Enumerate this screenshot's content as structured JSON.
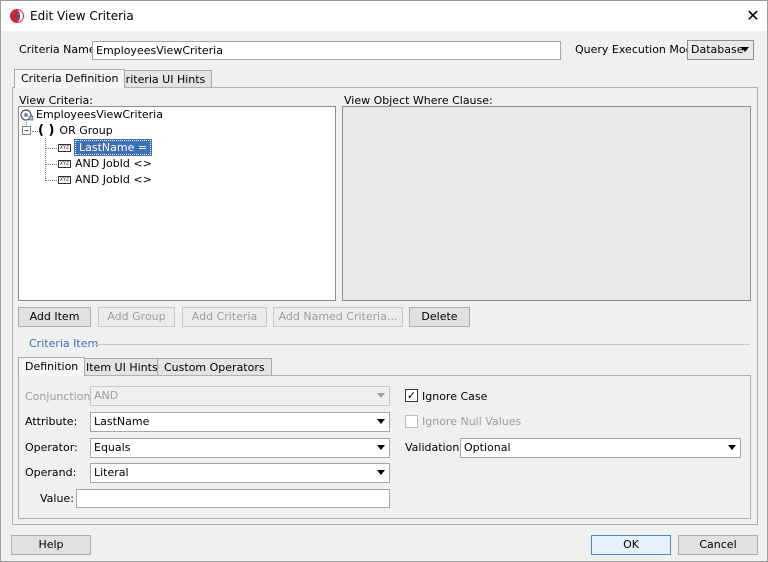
{
  "window": {
    "title": "Edit View Criteria",
    "close_glyph": "✕"
  },
  "header": {
    "criteria_name_label": "Criteria Name:",
    "criteria_name_value": "EmployeesViewCriteria",
    "qem_label": "Query Execution Mode:",
    "qem_value": "Database"
  },
  "outer_tabs": [
    {
      "label": "Criteria Definition",
      "active": true
    },
    {
      "label": "Criteria UI Hints",
      "active": false
    }
  ],
  "view_criteria": {
    "label": "View Criteria:",
    "tree": {
      "root": "EmployeesViewCriteria",
      "group_glyph": "( )",
      "group": "OR Group",
      "items": [
        "LastName =",
        "AND JobId <>",
        "AND JobId <>"
      ]
    }
  },
  "where_clause": {
    "label": "View Object Where Clause:"
  },
  "action_buttons": {
    "add_item": "Add Item",
    "add_group": "Add Group",
    "add_criteria": "Add Criteria",
    "add_named_criteria": "Add Named Criteria...",
    "delete": "Delete"
  },
  "criteria_item": {
    "section_title": "Criteria Item",
    "tabs": [
      {
        "label": "Definition",
        "active": true
      },
      {
        "label": "Item UI Hints",
        "active": false
      },
      {
        "label": "Custom Operators",
        "active": false
      }
    ],
    "conjunction_label": "Conjunction:",
    "conjunction_value": "AND",
    "attribute_label": "Attribute:",
    "attribute_value": "LastName",
    "operator_label": "Operator:",
    "operator_value": "Equals",
    "operand_label": "Operand:",
    "operand_value": "Literal",
    "value_label": "Value:",
    "value_value": "",
    "ignore_case_label": "Ignore Case",
    "ignore_case_checked": true,
    "ignore_null_label": "Ignore Null Values",
    "ignore_null_checked": false,
    "validation_label": "Validation:",
    "validation_value": "Optional"
  },
  "footer": {
    "help": "Help",
    "ok": "OK",
    "cancel": "Cancel"
  },
  "icons": {
    "checkmark": "✓",
    "minus": "−",
    "xyz": "XYZ"
  }
}
